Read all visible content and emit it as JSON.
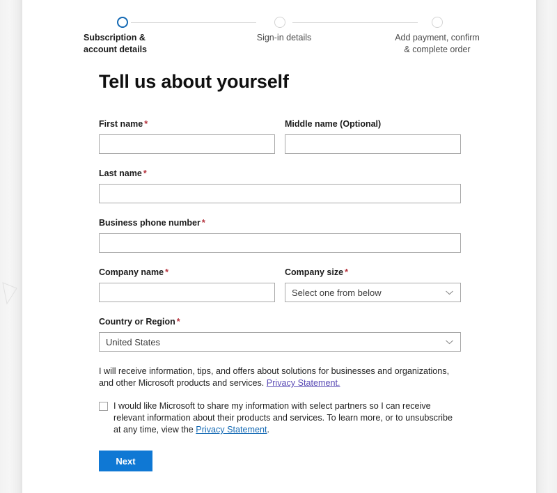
{
  "stepper": {
    "steps": [
      {
        "label_line1": "Subscription &",
        "label_line2": "account details",
        "state": "active"
      },
      {
        "label_line1": "Sign-in details",
        "label_line2": "",
        "state": "inactive"
      },
      {
        "label_line1": "Add payment, confirm",
        "label_line2": "& complete order",
        "state": "inactive"
      }
    ],
    "active_color": "#1268b3",
    "inactive_color": "#d3d3d3"
  },
  "page": {
    "title": "Tell us about yourself"
  },
  "form": {
    "first_name": {
      "label": "First name",
      "required_marker": "*",
      "value": "",
      "placeholder": ""
    },
    "middle_name": {
      "label": "Middle name (Optional)",
      "required_marker": "",
      "value": "",
      "placeholder": ""
    },
    "last_name": {
      "label": "Last name",
      "required_marker": "*",
      "value": "",
      "placeholder": ""
    },
    "business_phone": {
      "label": "Business phone number",
      "required_marker": "*",
      "value": "",
      "placeholder": ""
    },
    "company_name": {
      "label": "Company name",
      "required_marker": "*",
      "value": "",
      "placeholder": ""
    },
    "company_size": {
      "label": "Company size",
      "required_marker": "*",
      "selected": "Select one from below"
    },
    "country_region": {
      "label": "Country or Region",
      "required_marker": "*",
      "selected": "United States"
    }
  },
  "consent": {
    "text_before_link": "I will receive information, tips, and offers about solutions for businesses and organizations, and other Microsoft products and services. ",
    "link_text": "Privacy Statement.",
    "link_color": "#5a4bb5"
  },
  "optin": {
    "checked": false,
    "text_before_link": "I would like Microsoft to share my information with select partners so I can receive relevant information about their products and services. To learn more, or to unsubscribe at any time, view the ",
    "link_text": "Privacy Statement",
    "text_after_link": ".",
    "link_color": "#1268b3"
  },
  "actions": {
    "next_label": "Next",
    "next_color": "#0f78d4"
  }
}
